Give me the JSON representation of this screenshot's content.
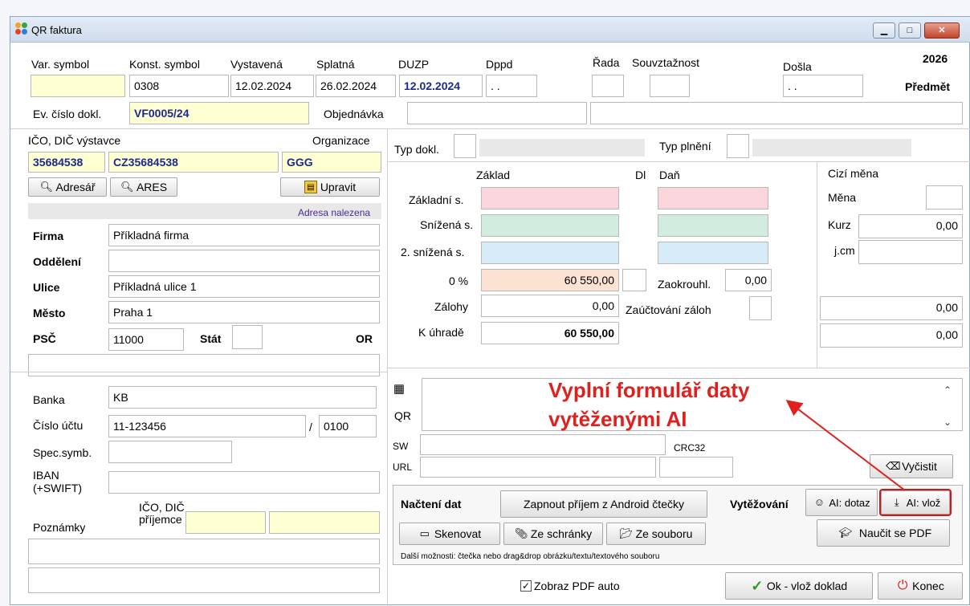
{
  "window": {
    "title": "QR faktura",
    "min": "▁",
    "max": "□",
    "close": "✕"
  },
  "header": {
    "var_symbol_label": "Var. symbol",
    "konst_symbol_label": "Konst. symbol",
    "vystavena_label": "Vystavená",
    "splatna_label": "Splatná",
    "duzp_label": "DUZP",
    "dppd_label": "Dppd",
    "rada_label": "Řada",
    "souvztaznost_label": "Souvztažnost",
    "dosla_label": "Došla",
    "year": "2026",
    "predmet_label": "Předmět",
    "var_symbol": "",
    "konst_symbol": "0308",
    "vystavena": "12.02.2024",
    "splatna": "26.02.2024",
    "duzp": "12.02.2024",
    "dppd": ". .",
    "rada": "",
    "souvztaznost": "",
    "dosla": ". .",
    "ev_cislo_label": "Ev. číslo dokl.",
    "ev_cislo": "VF0005/24",
    "objednavka_label": "Objednávka",
    "objednavka": "",
    "predmet": ""
  },
  "issuer": {
    "ico_dic_label": "IČO, DIČ výstavce",
    "organizace_label": "Organizace",
    "ico": "35684538",
    "dic": "CZ35684538",
    "organizace": "GGG",
    "adresar_button": "Adresář",
    "ares_button": "ARES",
    "upravit_button": "Upravit",
    "adresa_status": "Adresa nalezena",
    "firma_label": "Firma",
    "firma": "Příkladná firma",
    "oddeleni_label": "Oddělení",
    "oddeleni": "",
    "ulice_label": "Ulice",
    "ulice": "Příkladná ulice 1",
    "mesto_label": "Město",
    "mesto": "Praha 1",
    "psc_label": "PSČ",
    "psc": "11000",
    "stat_label": "Stát",
    "stat": "",
    "or_label": "OR",
    "extra": ""
  },
  "bank": {
    "banka_label": "Banka",
    "banka": "KB",
    "cislo_uctu_label": "Číslo účtu",
    "cislo_uctu": "11-123456",
    "slash": "/",
    "kod_banky": "0100",
    "spec_symb_label": "Spec.symb.",
    "spec_symb": "",
    "iban_label": "IBAN",
    "swift_label": "(+SWIFT)",
    "iban": "",
    "prijemce_label1": "IČO, DIČ",
    "prijemce_label2": "příjemce",
    "prijemce_ico": "",
    "prijemce_dic": "",
    "poznamky_label": "Poznámky",
    "poznamky1": "",
    "poznamky2": ""
  },
  "amounts": {
    "typ_dokl_label": "Typ dokl.",
    "typ_plneni_label": "Typ plnění",
    "zaklad_label": "Základ",
    "dl_label": "Dl",
    "dan_label": "Daň",
    "cizi_mena_label": "Cizí měna",
    "zakladni_label": "Základní s.",
    "snizena_label": "Snížená s.",
    "snizena2_label": "2. snížená s.",
    "nula_label": "0 %",
    "zalohy_label": "Zálohy",
    "k_uhrade_label": "K úhradě",
    "nula_zaklad": "60 550,00",
    "zaokrouhl_label": "Zaokrouhl.",
    "zaokrouhl": "0,00",
    "zalohy": "0,00",
    "zauctovani_label": "Zaúčtování záloh",
    "k_uhrade": "60 550,00",
    "mena_label": "Měna",
    "mena": "",
    "kurz_label": "Kurz",
    "kurz": "0,00",
    "jcm_label": "j.cm",
    "jcm": "",
    "cizi1": "0,00",
    "cizi2": "0,00"
  },
  "qr": {
    "qr_label": "QR",
    "sw_label": "SW",
    "url_label": "URL",
    "crc_label": "CRC32",
    "qr_text": "",
    "sw": "",
    "url": "",
    "crc": "",
    "vycistit_button": "Vyčistit"
  },
  "load": {
    "nacteni_label": "Načtení dat",
    "android_button": "Zapnout příjem z Android čtečky",
    "vytezovani_label": "Vytěžování",
    "ai_dotaz_button": "AI: dotaz",
    "ai_vloz_button": "AI: vlož",
    "skenovat_button": "Skenovat",
    "schranka_button": "Ze schránky",
    "soubor_button": "Ze souboru",
    "naucit_button": "Naučit se PDF",
    "hint": "Další možnosti: čtečka nebo drag&drop obrázku/textu/textového souboru"
  },
  "footer": {
    "zobraz_pdf_label": "Zobraz PDF auto",
    "zobraz_pdf_checked": true,
    "ok_button": "Ok - vlož doklad",
    "konec_button": "Konec"
  },
  "annotation": {
    "line1": "Vyplní formulář daty",
    "line2": "vytěženými AI"
  }
}
